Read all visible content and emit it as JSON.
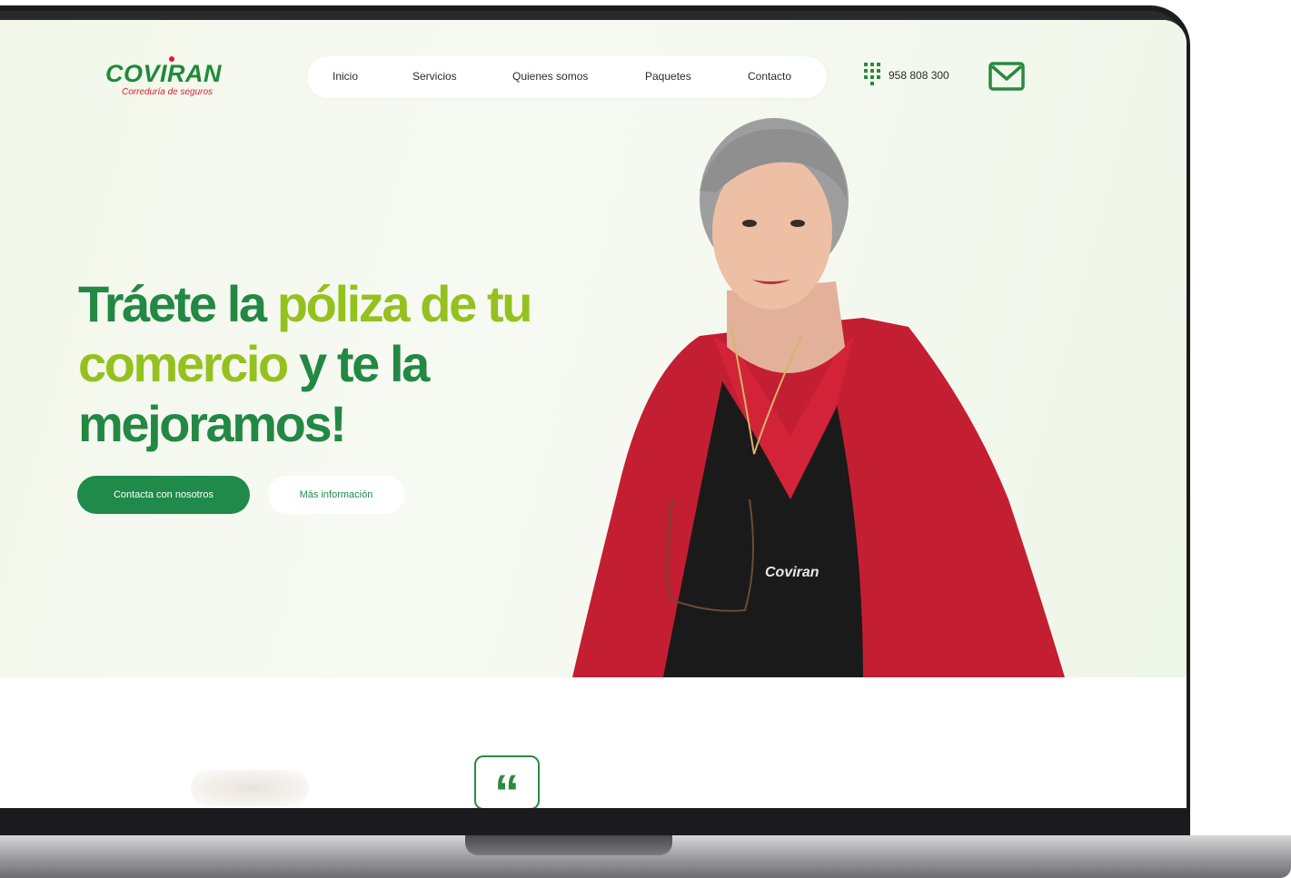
{
  "brand": {
    "name": "COVIRAN",
    "tagline": "Correduría de seguros",
    "green": "#1f8a3a",
    "red": "#e11b2b"
  },
  "nav": {
    "items": [
      {
        "label": "Inicio"
      },
      {
        "label": "Servicios"
      },
      {
        "label": "Quienes somos"
      },
      {
        "label": "Paquetes"
      },
      {
        "label": "Contacto"
      }
    ]
  },
  "contact": {
    "phone": "958 808 300",
    "phone_icon": "keypad-icon",
    "mail_icon": "mail-icon"
  },
  "hero": {
    "headline_parts": [
      {
        "text": "Tráete la ",
        "tone": "dark"
      },
      {
        "text": "póliza de tu comercio ",
        "tone": "lime"
      },
      {
        "text": "y te la mejoramos!",
        "tone": "dark"
      }
    ],
    "primary_cta": "Contacta con nosotros",
    "secondary_cta": "Más información",
    "shirt_logo": "Coviran"
  },
  "testimonial": {
    "quote_glyph": "“"
  },
  "colors": {
    "dark_green": "#238844",
    "lime": "#95c11f",
    "button_green": "#1f8a4a"
  }
}
